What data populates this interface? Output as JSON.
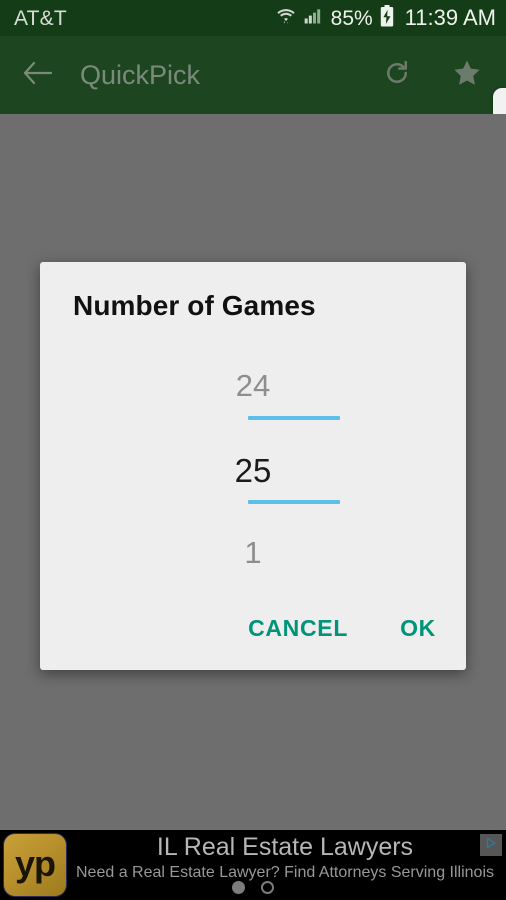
{
  "status_bar": {
    "carrier": "AT&T",
    "battery_percent": "85%",
    "time": "11:39 AM",
    "wifi_icon": "wifi-icon",
    "signal_icon": "cellular-signal-icon",
    "battery_icon": "battery-charging-icon",
    "background_color": "#143d17"
  },
  "app_bar": {
    "title": "QuickPick",
    "back_icon": "back-arrow-icon",
    "refresh_icon": "refresh-icon",
    "star_icon": "star-icon",
    "background_color": "#1d4620",
    "title_color": "#7c8a7c"
  },
  "dialog": {
    "title": "Number of Games",
    "picker": {
      "previous_value": "24",
      "selected_value": "25",
      "next_value": "1",
      "highlight_color": "#5bc0e8"
    },
    "cancel_label": "CANCEL",
    "ok_label": "OK",
    "button_color": "#009479",
    "background_color": "#eeeeee"
  },
  "ad": {
    "logo_text": "yp",
    "headline": "IL Real Estate Lawyers",
    "subtext": "Need a Real Estate Lawyer? Find Attorneys Serving Illinois",
    "adchoices_icon": "adchoices-icon",
    "dots": [
      {
        "state": "filled"
      },
      {
        "state": "hollow"
      }
    ]
  }
}
